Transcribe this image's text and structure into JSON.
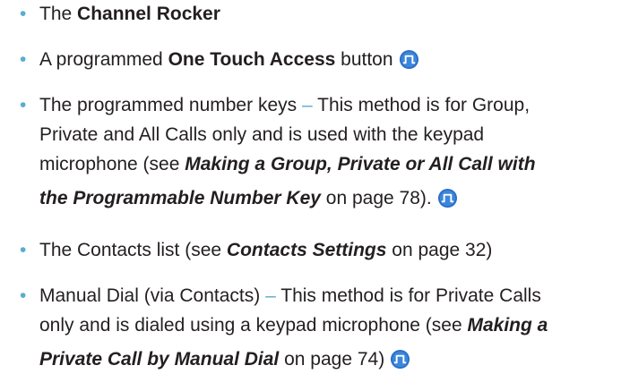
{
  "bullet_char": "•",
  "dash": "–",
  "items": [
    {
      "pre": "The ",
      "bold": "Channel Rocker"
    },
    {
      "pre": "A programmed ",
      "bold": "One Touch Access",
      "post": " button",
      "icon": "programmable-button-icon"
    },
    {
      "line1": "The programmed number keys ",
      "line1_post": " This method is for Group,",
      "line2": "Private and All Calls only and is used with the keypad",
      "line3": "microphone (see ",
      "ref": "Making a Group, Private or All Call with",
      "ref2": "the Programmable Number Key",
      "post": " on page 78).",
      "icon": "programmable-button-icon"
    },
    {
      "pre": "The Contacts list (see ",
      "ref": "Contacts Settings",
      "post": " on page 32)"
    },
    {
      "line1": "Manual Dial (via Contacts) ",
      "line1_post": " This method is for Private Calls",
      "line2": "only and is dialed using a keypad microphone (see ",
      "ref": "Making a",
      "ref2": "Private Call by Manual Dial",
      "post": " on page 74)",
      "icon": "programmable-button-icon"
    }
  ],
  "colors": {
    "text": "#231f20",
    "bullet": "#58aed0",
    "icon_fill": "#2a6fc9"
  }
}
